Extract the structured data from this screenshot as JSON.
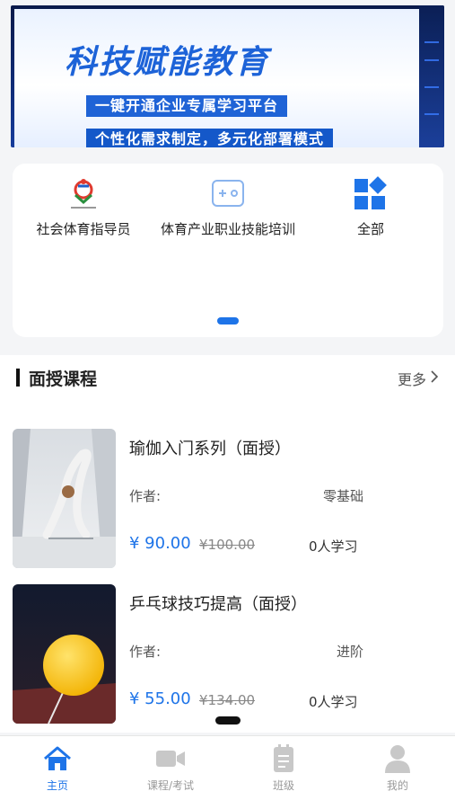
{
  "banner": {
    "headline": "科技赋能教育",
    "tag1": "一键开通企业专属学习平台",
    "tag2": "个性化需求制定，多元化部署模式"
  },
  "categories": [
    {
      "label": "社会体育指导员",
      "icon": "sports-association-logo-icon"
    },
    {
      "label": "体育产业职业技能培训",
      "icon": "gamepad-icon"
    },
    {
      "label": "全部",
      "icon": "grid-all-icon"
    }
  ],
  "section": {
    "title": "面授课程",
    "more_label": "更多"
  },
  "courses": [
    {
      "title": "瑜伽入门系列（面授）",
      "author_label": "作者:",
      "level": "零基础",
      "price": "¥ 90.00",
      "original_price": "¥100.00",
      "learners": "0人学习"
    },
    {
      "title": "乒乓球技巧提高（面授）",
      "author_label": "作者:",
      "level": "进阶",
      "price": "¥ 55.00",
      "original_price": "¥134.00",
      "learners": "0人学习"
    }
  ],
  "tabbar": [
    {
      "label": "主页",
      "icon": "home-icon",
      "active": true
    },
    {
      "label": "课程/考试",
      "icon": "video-camera-icon",
      "active": false
    },
    {
      "label": "班级",
      "icon": "notebook-icon",
      "active": false
    },
    {
      "label": "我的",
      "icon": "user-icon",
      "active": false
    }
  ],
  "colors": {
    "accent": "#1e74e8",
    "inactive": "#999999"
  }
}
